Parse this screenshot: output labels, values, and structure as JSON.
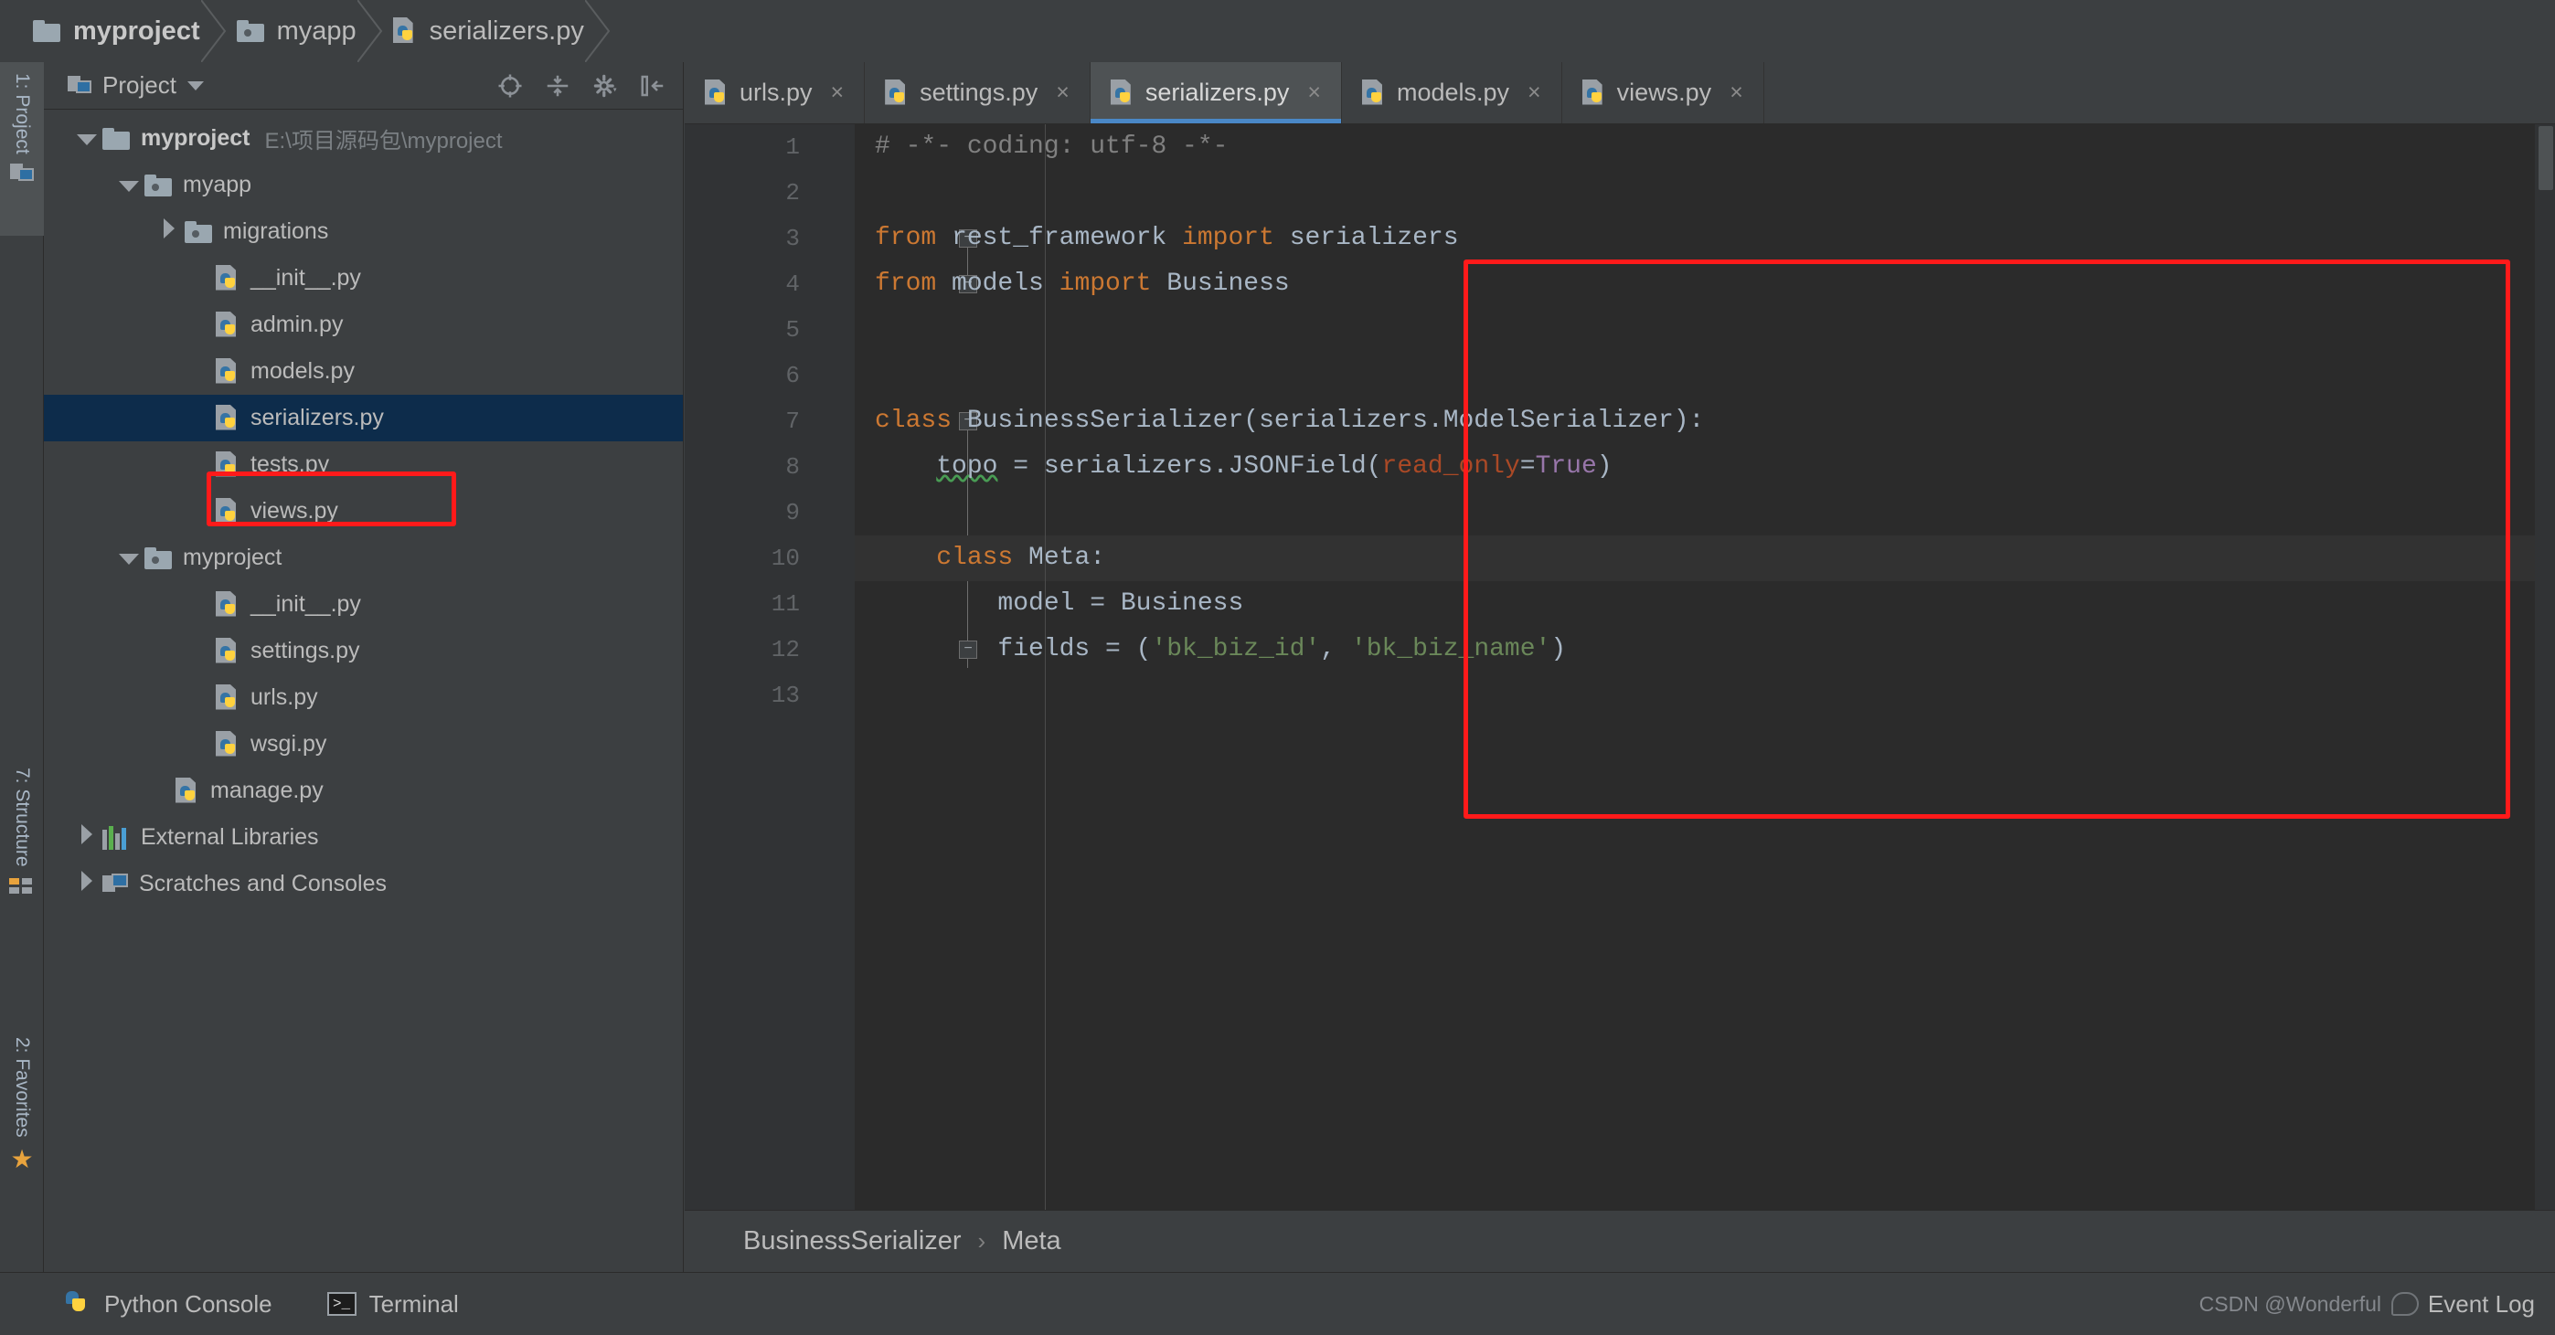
{
  "navbar": {
    "crumbs": [
      {
        "label": "myproject",
        "icon": "folder-icon"
      },
      {
        "label": "myapp",
        "icon": "source-folder-icon"
      },
      {
        "label": "serializers.py",
        "icon": "python-file-icon"
      }
    ]
  },
  "left_strip": {
    "tabs": [
      {
        "label": "1: Project",
        "icon": "project-window-icon",
        "active": true
      },
      {
        "label": "7: Structure",
        "icon": "structure-icon",
        "active": false
      },
      {
        "label": "2: Favorites",
        "icon": "star-icon",
        "active": false
      }
    ]
  },
  "project_panel": {
    "title": "Project",
    "toolbar_icons": [
      "locate-target-icon",
      "collapse-all-icon",
      "settings-gear-icon",
      "hide-panel-icon"
    ],
    "tree": [
      {
        "label": "myproject",
        "path": "E:\\项目源码包\\myproject",
        "icon": "folder-icon",
        "twisty": "down",
        "indent": 0,
        "bold": true,
        "selected": false
      },
      {
        "label": "myapp",
        "path": "",
        "icon": "source-folder-icon",
        "twisty": "down",
        "indent": 1,
        "bold": false,
        "selected": false
      },
      {
        "label": "migrations",
        "path": "",
        "icon": "source-folder-icon",
        "twisty": "right",
        "indent": 2,
        "bold": false,
        "selected": false
      },
      {
        "label": "__init__.py",
        "path": "",
        "icon": "python-file-icon",
        "twisty": "",
        "indent": 3,
        "bold": false,
        "selected": false
      },
      {
        "label": "admin.py",
        "path": "",
        "icon": "python-file-icon",
        "twisty": "",
        "indent": 3,
        "bold": false,
        "selected": false
      },
      {
        "label": "models.py",
        "path": "",
        "icon": "python-file-icon",
        "twisty": "",
        "indent": 3,
        "bold": false,
        "selected": false
      },
      {
        "label": "serializers.py",
        "path": "",
        "icon": "python-file-icon",
        "twisty": "",
        "indent": 3,
        "bold": false,
        "selected": true
      },
      {
        "label": "tests.py",
        "path": "",
        "icon": "python-file-icon",
        "twisty": "",
        "indent": 3,
        "bold": false,
        "selected": false
      },
      {
        "label": "views.py",
        "path": "",
        "icon": "python-file-icon",
        "twisty": "",
        "indent": 3,
        "bold": false,
        "selected": false
      },
      {
        "label": "myproject",
        "path": "",
        "icon": "source-folder-icon",
        "twisty": "down",
        "indent": 1,
        "bold": false,
        "selected": false
      },
      {
        "label": "__init__.py",
        "path": "",
        "icon": "python-file-icon",
        "twisty": "",
        "indent": 3,
        "bold": false,
        "selected": false
      },
      {
        "label": "settings.py",
        "path": "",
        "icon": "python-file-icon",
        "twisty": "",
        "indent": 3,
        "bold": false,
        "selected": false
      },
      {
        "label": "urls.py",
        "path": "",
        "icon": "python-file-icon",
        "twisty": "",
        "indent": 3,
        "bold": false,
        "selected": false
      },
      {
        "label": "wsgi.py",
        "path": "",
        "icon": "python-file-icon",
        "twisty": "",
        "indent": 3,
        "bold": false,
        "selected": false
      },
      {
        "label": "manage.py",
        "path": "",
        "icon": "python-file-icon",
        "twisty": "",
        "indent": 2,
        "bold": false,
        "selected": false
      },
      {
        "label": "External Libraries",
        "path": "",
        "icon": "libraries-icon",
        "twisty": "right",
        "indent": 0,
        "bold": false,
        "selected": false
      },
      {
        "label": "Scratches and Consoles",
        "path": "",
        "icon": "scratches-icon",
        "twisty": "right",
        "indent": 0,
        "bold": false,
        "selected": false
      }
    ]
  },
  "editor": {
    "tabs": [
      {
        "label": "urls.py",
        "active": false
      },
      {
        "label": "settings.py",
        "active": false
      },
      {
        "label": "serializers.py",
        "active": true
      },
      {
        "label": "models.py",
        "active": false
      },
      {
        "label": "views.py",
        "active": false
      }
    ],
    "close_glyph": "×",
    "line_numbers": [
      "1",
      "2",
      "3",
      "4",
      "5",
      "6",
      "7",
      "8",
      "9",
      "10",
      "11",
      "12",
      "13"
    ],
    "code_lines": [
      {
        "n": 1,
        "text": "# -*- coding: utf-8 -*-"
      },
      {
        "n": 2,
        "text": ""
      },
      {
        "n": 3,
        "text": "from rest_framework import serializers"
      },
      {
        "n": 4,
        "text": "from models import Business"
      },
      {
        "n": 5,
        "text": ""
      },
      {
        "n": 6,
        "text": ""
      },
      {
        "n": 7,
        "text": "class BusinessSerializer(serializers.ModelSerializer):"
      },
      {
        "n": 8,
        "text": "    topo = serializers.JSONField(read_only=True)"
      },
      {
        "n": 9,
        "text": ""
      },
      {
        "n": 10,
        "text": "    class Meta:"
      },
      {
        "n": 11,
        "text": "        model = Business"
      },
      {
        "n": 12,
        "text": "        fields = ('bk_biz_id', 'bk_biz_name')"
      },
      {
        "n": 13,
        "text": ""
      }
    ],
    "breadcrumb": {
      "class_name": "BusinessSerializer",
      "separator": "›",
      "member": "Meta"
    }
  },
  "status_bar": {
    "items": [
      {
        "label": "Python Console",
        "icon": "python-console-icon"
      },
      {
        "label": "Terminal",
        "icon": "terminal-icon"
      }
    ],
    "event_log": "Event Log",
    "watermark": "CSDN @Wonderful"
  },
  "colors": {
    "background": "#3c3f41",
    "editor_background": "#2b2b2b",
    "selection": "#0d2c4b",
    "accent": "#4a88c7",
    "annotation": "#ff1a1a",
    "keyword": "#cc7832",
    "string": "#6a8759",
    "comment": "#808080",
    "param": "#aa4926",
    "builtin": "#9876aa",
    "text": "#a9b7c6"
  }
}
